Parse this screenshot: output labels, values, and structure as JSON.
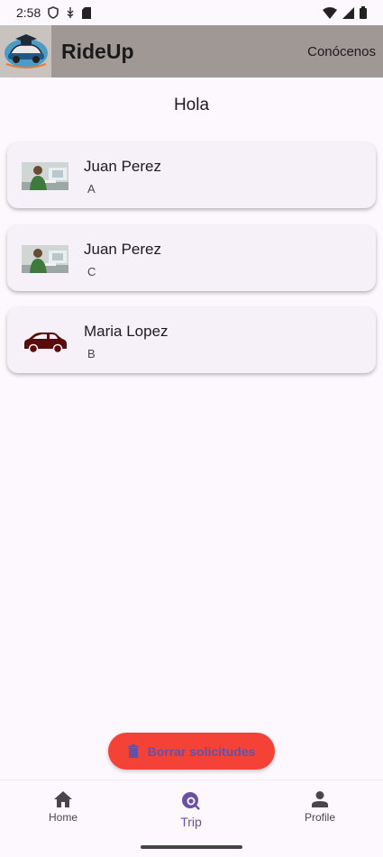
{
  "status_bar": {
    "time": "2:58"
  },
  "app_bar": {
    "title": "RideUp",
    "action_label": "Conócenos"
  },
  "greeting": "Hola",
  "requests": [
    {
      "name": "Juan Perez",
      "subtitle": "A",
      "image": "person-photo"
    },
    {
      "name": "Juan Perez",
      "subtitle": "C",
      "image": "person-photo"
    },
    {
      "name": "Maria Lopez",
      "subtitle": "B",
      "image": "car-icon"
    }
  ],
  "fab": {
    "label": "Borrar solicitudes",
    "icon": "trash-icon",
    "color": "#f44336"
  },
  "bottom_nav": {
    "items": [
      {
        "label": "Home",
        "icon": "home-icon"
      },
      {
        "label": "Trip",
        "icon": "trip-search-icon",
        "active": true
      },
      {
        "label": "Profile",
        "icon": "person-icon"
      }
    ]
  },
  "colors": {
    "accent": "#6750a4",
    "app_bar": "#a09895",
    "background": "#fdf7fe",
    "card": "#f6f0f8"
  }
}
